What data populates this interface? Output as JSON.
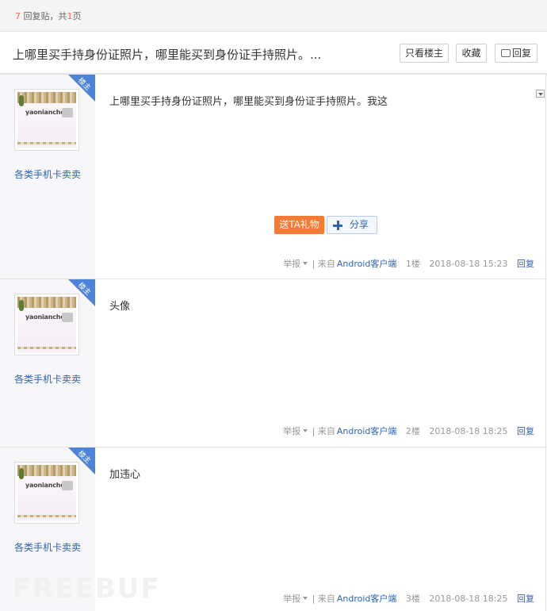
{
  "topbar": {
    "reply_count": "7",
    "reply_label": "回复贴，共",
    "page_count": "1",
    "page_unit": "页"
  },
  "thread": {
    "title": "上哪里买手持身份证照片，哪里能买到身份证手持照片。..."
  },
  "toolbar": {
    "only_op": "只看楼主",
    "favorite": "收藏",
    "reply": "回复"
  },
  "posts": [
    {
      "badge": "楼主",
      "avatar_text": "yaonianchen",
      "username": "各类手机卡卖卖",
      "content": "上哪里买手持身份证照片，哪里能买到身份证手持照片。我这",
      "gift_label": "送TA礼物",
      "share_label": "分享",
      "report": "举报",
      "source_prefix": "| 来自",
      "source": "Android客户端",
      "floor": "1楼",
      "time": "2018-08-18 15:23",
      "reply": "回复"
    },
    {
      "badge": "楼主",
      "avatar_text": "yaonianchen",
      "username": "各类手机卡卖卖",
      "content": "头像",
      "report": "举报",
      "source_prefix": "| 来自",
      "source": "Android客户端",
      "floor": "2楼",
      "time": "2018-08-18 18:25",
      "reply": "回复"
    },
    {
      "badge": "楼主",
      "avatar_text": "yaonianche",
      "username": "各类手机卡卖卖",
      "content": "加违心",
      "report": "举报",
      "source_prefix": "| 来自",
      "source": "Android客户端",
      "floor": "3楼",
      "time": "2018-08-18 18:25",
      "reply": "回复"
    }
  ],
  "watermark": "FREEBUF",
  "colors": {
    "accent_blue": "#2d64b3",
    "badge_blue": "#4c84d9",
    "gift_orange": "#f37b35",
    "count_orange": "#f26c4f"
  }
}
